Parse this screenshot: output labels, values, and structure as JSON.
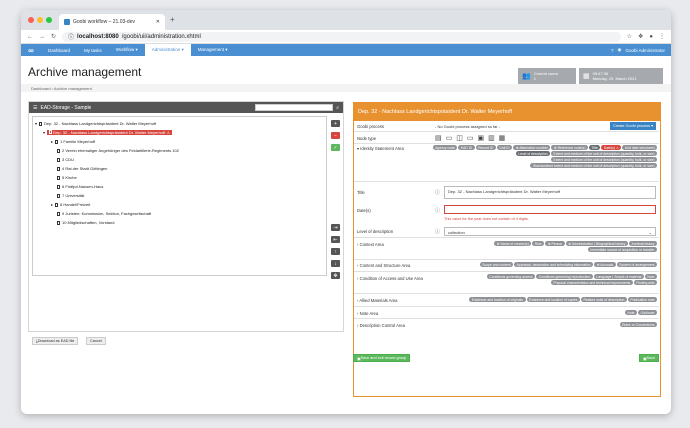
{
  "browser": {
    "tab_title": "Goobi workflow – 21.03-dev",
    "url_host": "localhost:8080",
    "url_path": "/goobi/uii/administration.xhtml",
    "colors": {
      "close": "#fe5f57",
      "min": "#febc2e",
      "max": "#28c840"
    }
  },
  "nav": {
    "items": [
      "Dashboard",
      "My tasks",
      "Workflow ▾",
      "Administration ▾",
      "Management ▾"
    ],
    "active": 3,
    "user": "Goobi Administrator"
  },
  "page": {
    "title": "Archive management",
    "breadcrumb": "Dashboard › Archive management"
  },
  "tiles": {
    "users_label": "Current users",
    "users_count": "1",
    "time": "09:47:36",
    "date": "Monday, 29. March 2021"
  },
  "left": {
    "title": "EAD-Storage - Sample",
    "search_placeholder": "",
    "tree": [
      {
        "label": "Dep. 32 - Nachlass Landgerichtspräsident Dr. Walter Meyerhoff",
        "level": 0,
        "toggle": "▾"
      },
      {
        "label": "Dep. 32 - Nachlass Landgerichtspräsident Dr. Walter Meyerhoff",
        "level": 1,
        "toggle": "▾",
        "selected": true
      },
      {
        "label": "1 Familie Meyerhoff",
        "level": 2,
        "toggle": "▸"
      },
      {
        "label": "2 Verein ehemaliger Angehöriger des Feldartillerie-Regiments 102",
        "level": 2,
        "toggle": ""
      },
      {
        "label": "3 CDU",
        "level": 2,
        "toggle": ""
      },
      {
        "label": "4 Rat der Stadt Göttingen",
        "level": 2,
        "toggle": ""
      },
      {
        "label": "5 Kirche",
        "level": 2,
        "toggle": ""
      },
      {
        "label": "6 Fridtjof-Nansen-Haus",
        "level": 2,
        "toggle": ""
      },
      {
        "label": "7 Universität",
        "level": 2,
        "toggle": ""
      },
      {
        "label": "8 Handel/Freizeit",
        "level": 2,
        "toggle": "▸"
      },
      {
        "label": "9 Juristen: Kommission, Sektion, Fachgesellschaft",
        "level": 2,
        "toggle": ""
      },
      {
        "label": "10 Mitgliedschaften, Vorstand",
        "level": 2,
        "toggle": ""
      }
    ],
    "side_buttons": [
      "+",
      "−",
      "✓",
      "⇥",
      "⇤",
      "↑",
      "↓",
      "✥"
    ],
    "download": "Download as EAD file",
    "cancel": "Cancel"
  },
  "right": {
    "title": "Dep. 32 - Nachlass Landgerichtspräsident Dr. Walter Meyerhoff",
    "goobi_process_label": "Goobi process",
    "goobi_process_value": "- No Goobi process assigned so far -",
    "create_btn": "Create Goobi process ▾",
    "node_type_label": "Node type",
    "identity": {
      "label": "Identity Statement Area",
      "chips": [
        {
          "t": "Agency code"
        },
        {
          "t": "EAD ID"
        },
        {
          "t": "Record ID"
        },
        {
          "t": "Unit ID"
        },
        {
          "t": "Alternative number",
          "p": true
        },
        {
          "t": "Reference code(s)",
          "p": true
        },
        {
          "t": "Title",
          "d": true
        },
        {
          "t": "Date(s)",
          "r": true
        },
        {
          "t": "Unit date structured"
        },
        {
          "t": "Level of description",
          "d": true
        },
        {
          "t": "Extent and medium of the unit of description (quantity, bulk, or size)"
        },
        {
          "t": "Extent and medium of the unit of description (quantity, bulk, or size)"
        },
        {
          "t": "Standardized extent and medium of the unit of description (quantity, bulk, or size)"
        }
      ]
    },
    "title_label": "Title",
    "title_value": "Dep. 32 - Nachlass Landgerichtspräsident Dr. Walter Meyerhoff",
    "dates_label": "Date(s)",
    "dates_error": "This value for the year does not contain of 4 digits.",
    "level_label": "Level of description",
    "level_value": "collection",
    "sections": [
      {
        "label": "Context Area",
        "chips": [
          "Name of creator(s)",
          "Role",
          "Person",
          "Administrative | Biographical history",
          "Archival history",
          "Immediate source of acquisition or transfer"
        ]
      },
      {
        "label": "Content and Structure Area",
        "chips": [
          "Scope and content",
          "Appraisal, destruction and scheduling information",
          "Accruals",
          "System of arrangement"
        ]
      },
      {
        "label": "Condition of Access and Use Area",
        "chips": [
          "Conditions governing access",
          "Conditions governing reproduction",
          "Language | Scripts of material",
          "Note",
          "Physical characteristics and technical requirements",
          "Finding aids"
        ]
      },
      {
        "label": "Allied Materials Area",
        "chips": [
          "Existence and location of originals",
          "Existence and location of copies",
          "Related units of description",
          "Publication note"
        ]
      },
      {
        "label": "Note Area",
        "chips": [
          "Note",
          "Odd/note"
        ]
      },
      {
        "label": "Description Control Area",
        "chips": [
          "Rules or Conventions"
        ]
      }
    ],
    "save_exit": "Save and exit record group",
    "save": "Save"
  },
  "colors": {
    "nav": "#4a8fd2",
    "header_left": "#555555",
    "header_right": "#e8922f",
    "danger": "#d6453e",
    "success": "#5cb85c"
  }
}
